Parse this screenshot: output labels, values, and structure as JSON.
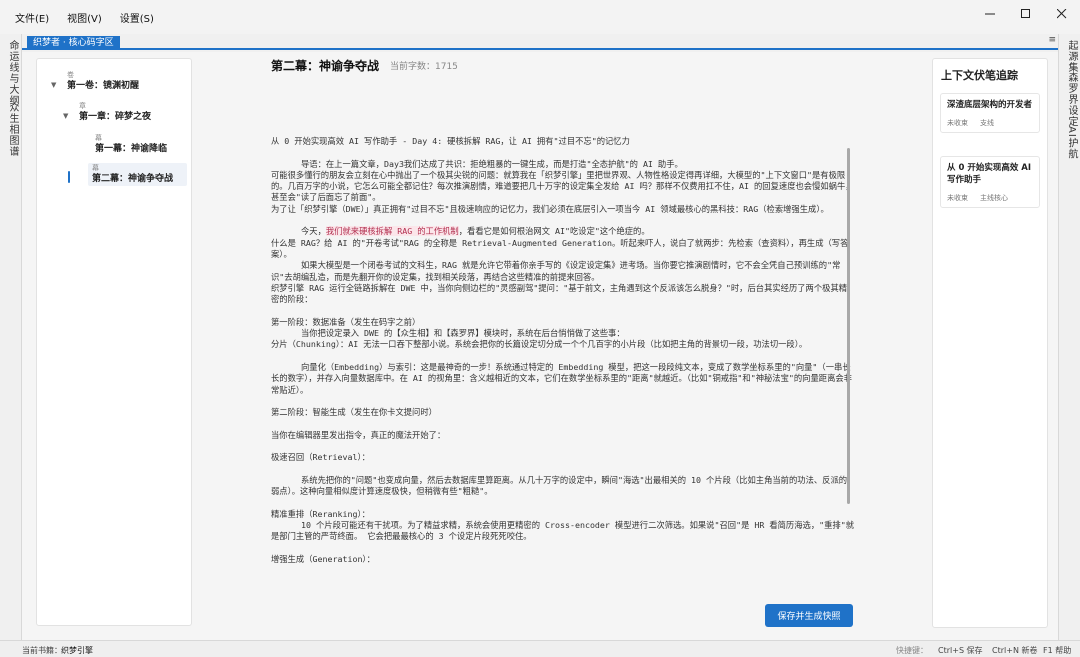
{
  "menu": [
    "文件(E)",
    "视图(V)",
    "设置(S)"
  ],
  "left_rail": [
    "命运线与大纲",
    "众生相图谱"
  ],
  "right_rail": [
    "起源集",
    "森罗界设定",
    "AI护航"
  ],
  "tab": {
    "label": "织梦者 · 核心码字区",
    "menu_icon": "≡"
  },
  "outline": {
    "volume": {
      "kind": "卷",
      "name": "第一卷：镜渊初醒"
    },
    "chapter": {
      "kind": "章",
      "name": "第一章：碎梦之夜"
    },
    "scenes": [
      {
        "kind": "幕",
        "name": "第一幕：神谕降临"
      },
      {
        "kind": "幕",
        "name": "第二幕：神谕争夺战"
      }
    ]
  },
  "editor": {
    "title": "第二幕：神谕争夺战",
    "word_count": "当前字数：1715",
    "lines": [
      {
        "text": "从 0 开始实现高效 AI 写作助手 - Day 4: 硬核拆解 RAG，让 AI 拥有\"过目不忘\"的记忆力"
      },
      {
        "text": ""
      },
      {
        "text": "      导语：在上一篇文章，Day3我们达成了共识：拒绝粗暴的一键生成，而是打造\"全态护航\"的 AI 助手。"
      },
      {
        "text": "可能很多懂行的朋友会立刻在心中抛出了一个极其尖锐的问题：就算我在「织梦引擎」里把世界观、人物性格设定得再详细，大模型的\"上下文窗口\"是有极限的。几百万字的小说，它怎么可能全都记住？每次推演剧情，难道要把几十万字的设定集全发给 AI 吗？那样不仅费用扛不住，AI 的回复速度也会慢如蜗牛，甚至会\"读了后面忘了前面\"。"
      },
      {
        "text": "为了让「织梦引擎（DWE）」真正拥有\"过目不忘\"且极速响应的记忆力，我们必须在底层引入一项当今 AI 领域最核心的黑科技：RAG（检索增强生成）。"
      },
      {
        "text": ""
      },
      {
        "pre": "      今天，",
        "hl": "我们就来硬核拆解 RAG 的工作机制",
        "post": "，看看它是如何根治网文 AI\"吃设定\"这个绝症的。"
      },
      {
        "text": "什么是 RAG？给 AI 的\"开卷考试\"RAG 的全称是 Retrieval-Augmented Generation。听起来吓人，说白了就两步：先检索（查资料），再生成（写答案）。"
      },
      {
        "text": "      如果大模型是一个闭卷考试的文科生，RAG 就是允许它带着你亲手写的《设定设定集》进考场。当你要它推演剧情时，它不会全凭自己预训练的\"常识\"去胡编乱造，而是先翻开你的设定集，找到相关段落，再结合这些精准的前提来回答。"
      },
      {
        "text": "织梦引擎 RAG 运行全链路拆解在 DWE 中，当你向侧边栏的\"灵感副驾\"提问：\"基于前文，主角遇到这个反派该怎么脱身？\"时，后台其实经历了两个极其精密的阶段："
      },
      {
        "text": ""
      },
      {
        "text": "第一阶段：数据准备（发生在码字之前）"
      },
      {
        "text": "      当你把设定录入 DWE 的【众生相】和【森罗界】模块时，系统在后台悄悄做了这些事："
      },
      {
        "text": "分片（Chunking）：AI 无法一口吞下整部小说。系统会把你的长篇设定切分成一个个几百字的小片段（比如把主角的背景切一段，功法切一段）。"
      },
      {
        "text": ""
      },
      {
        "text": "      向量化（Embedding）与索引：这是最神奇的一步！系统通过特定的 Embedding 模型，把这一段段纯文本，变成了数学坐标系里的\"向量\"（一串长长的数字），并存入向量数据库中。在 AI 的视角里：含义越相近的文本，它们在数学坐标系里的\"距离\"就越近。（比如\"铜戒指\"和\"神秘法宝\"的向量距离会非常贴近）。"
      },
      {
        "text": ""
      },
      {
        "text": "第二阶段：智能生成（发生在你卡文提问时）"
      },
      {
        "text": ""
      },
      {
        "text": "当你在编辑器里发出指令，真正的魔法开始了："
      },
      {
        "text": ""
      },
      {
        "text": "极速召回（Retrieval）："
      },
      {
        "text": ""
      },
      {
        "text": "      系统先把你的\"问题\"也变成向量，然后去数据库里算距离。从几十万字的设定中，瞬间\"海选\"出最相关的 10 个片段（比如主角当前的功法、反派的弱点）。这种向量相似度计算速度极快，但稍微有些\"粗糙\"。"
      },
      {
        "text": ""
      },
      {
        "text": "精准重排（Reranking）："
      },
      {
        "text": "      10 个片段可能还有干扰项。为了精益求精，系统会使用更精密的 Cross-encoder 模型进行二次筛选。如果说\"召回\"是 HR 看简历海选，\"重排\"就是部门主管的严苛终面。 它会把最最核心的 3 个设定片段死死咬住。"
      },
      {
        "text": ""
      },
      {
        "text": "增强生成（Generation）："
      }
    ],
    "save_button": "保存并生成快照"
  },
  "tracker": {
    "title": "上下文伏笔追踪",
    "cards": [
      {
        "title": "深渣底层架构的开发者",
        "tags": [
          "未收束",
          "支线"
        ]
      },
      {
        "title": "从 0 开始实现高效 AI 写作助手",
        "tags": [
          "未收束",
          "主线核心"
        ]
      }
    ]
  },
  "status": {
    "book": "当前书籍：",
    "book_name": "织梦引擎",
    "shortcuts_label": "快捷键：",
    "save_key": "Ctrl+S 保存",
    "new_key": "Ctrl+N 新卷",
    "help_key": "F1 帮助"
  }
}
